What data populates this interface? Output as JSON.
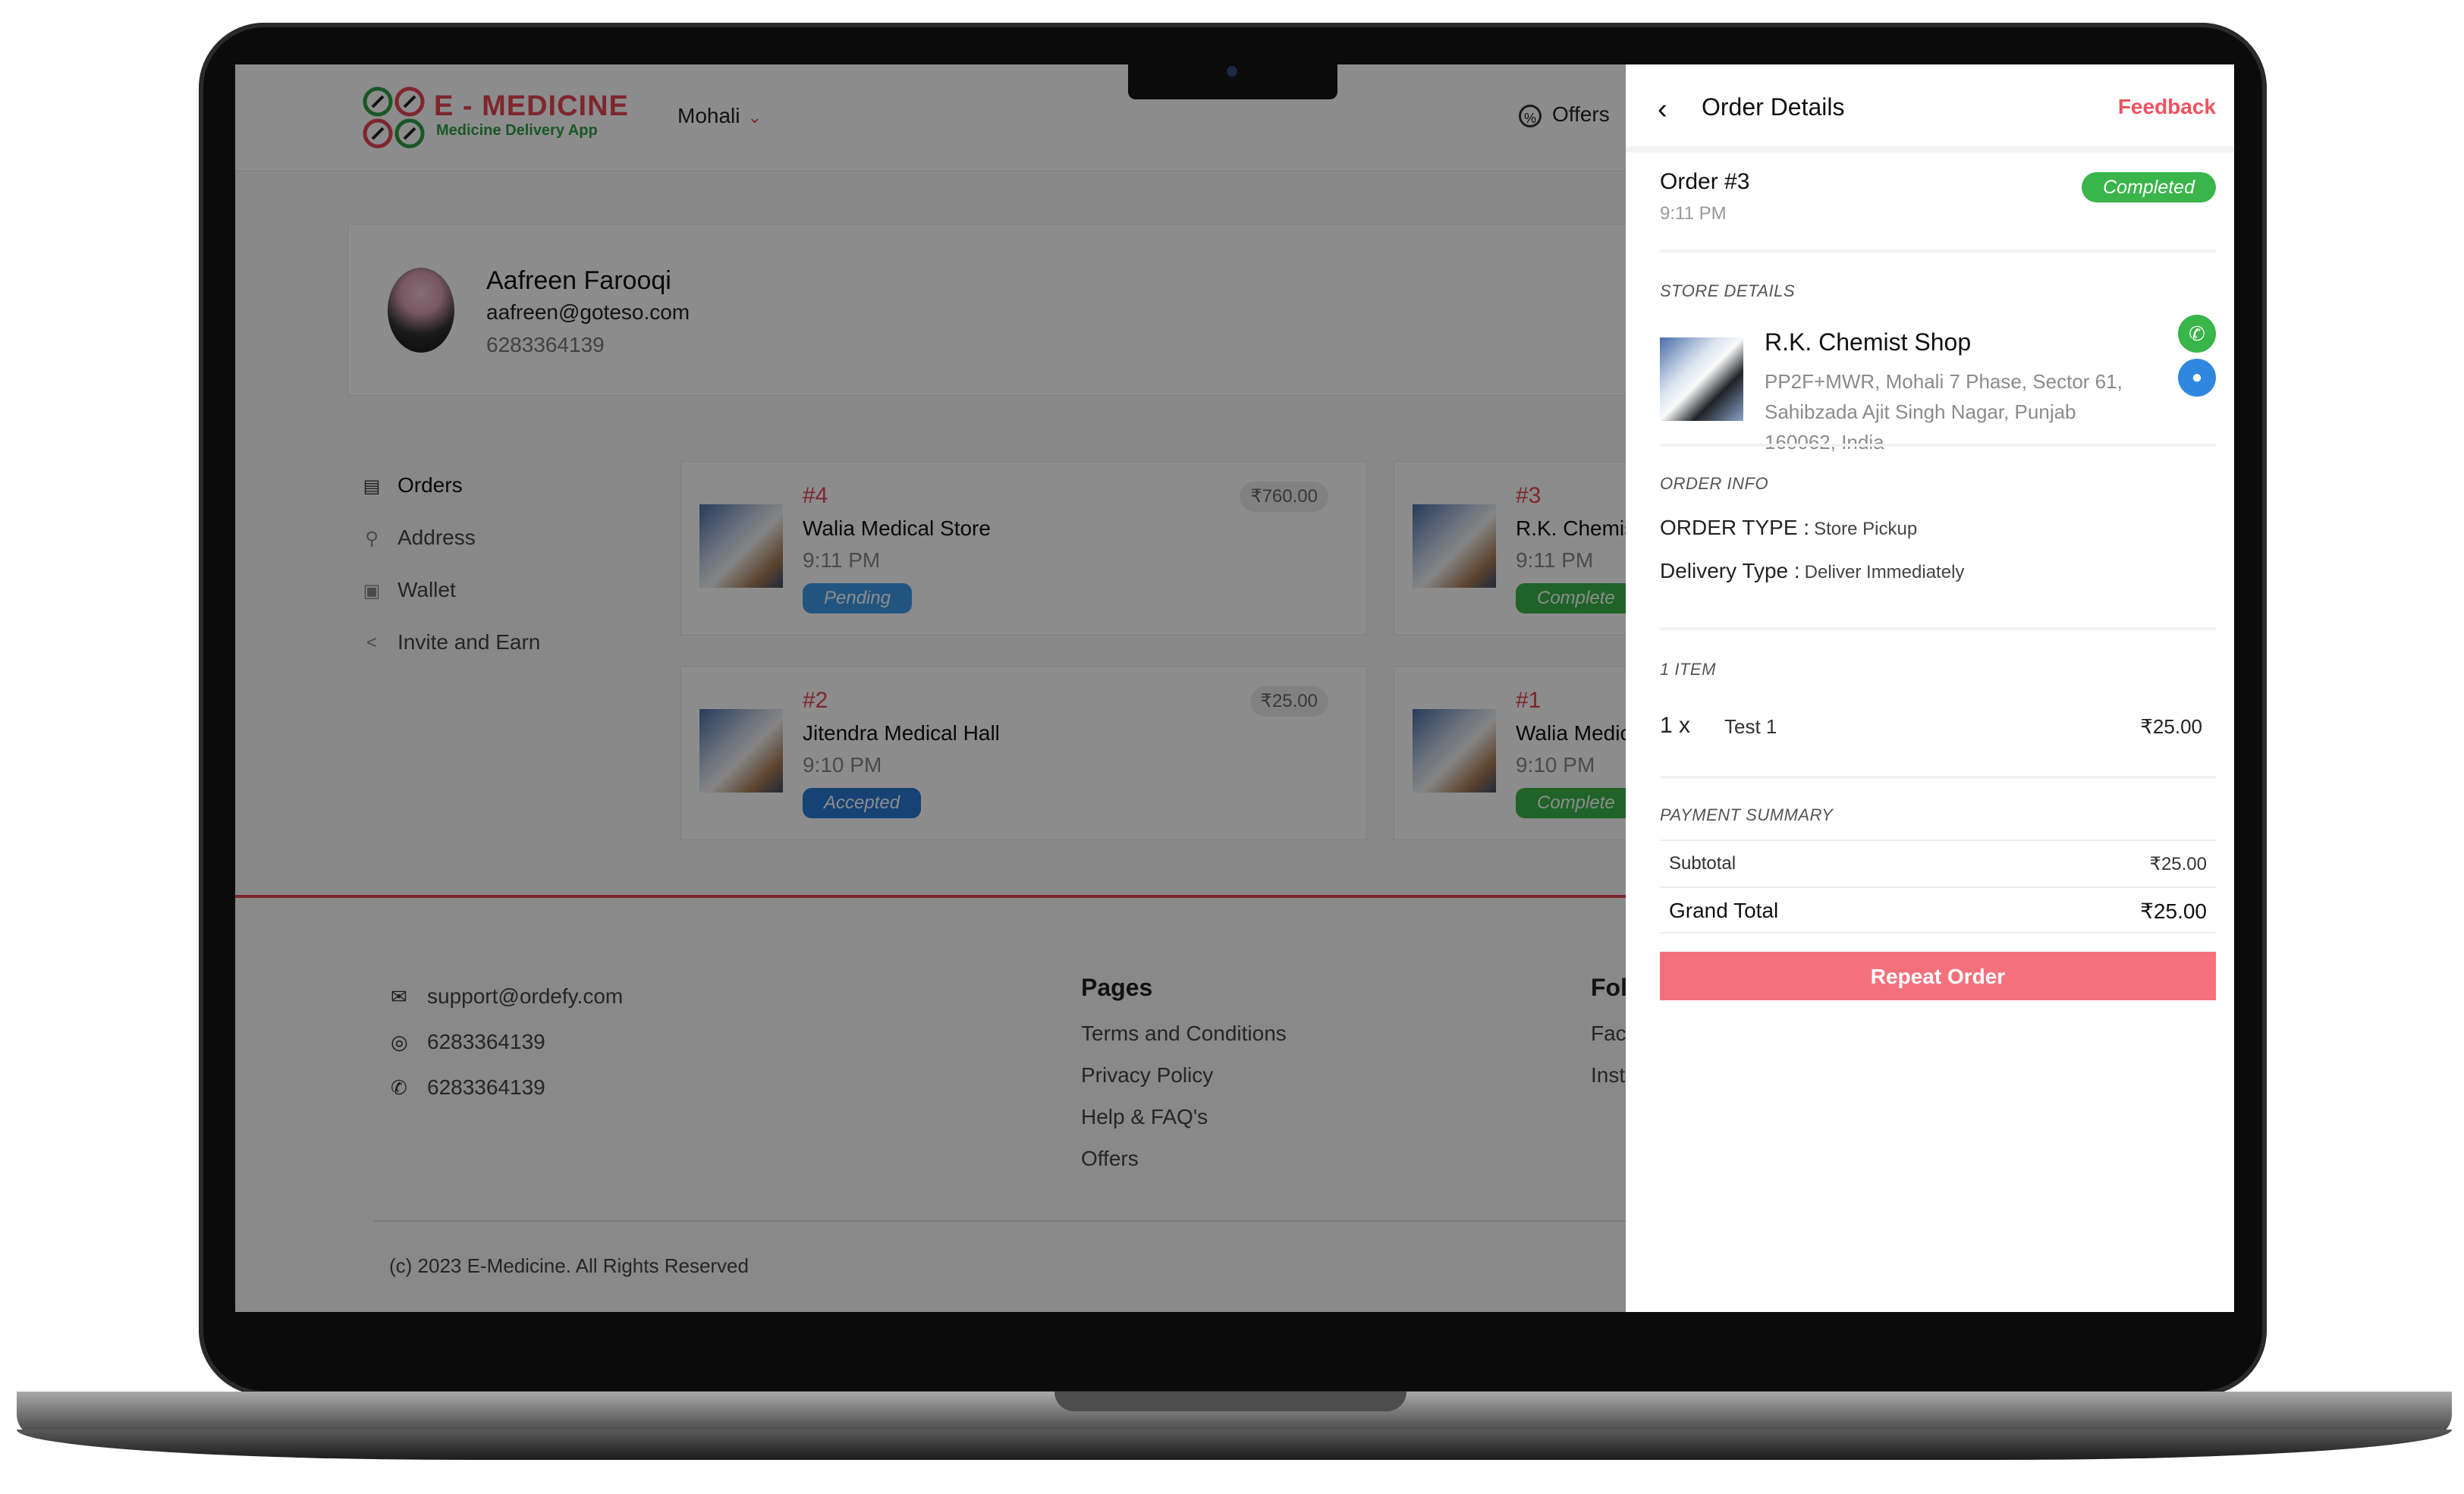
{
  "header": {
    "logo_title": "E - MEDICINE",
    "logo_subtitle": "Medicine Delivery App",
    "city": "Mohali",
    "offers_label": "Offers"
  },
  "profile": {
    "name": "Aafreen Farooqi",
    "email": "aafreen@goteso.com",
    "phone": "6283364139"
  },
  "menu": {
    "items": [
      {
        "label": "Orders",
        "icon": "clipboard-icon"
      },
      {
        "label": "Address",
        "icon": "location-pin-icon"
      },
      {
        "label": "Wallet",
        "icon": "wallet-icon"
      },
      {
        "label": "Invite and Earn",
        "icon": "share-icon"
      }
    ]
  },
  "orders": [
    {
      "id": "#4",
      "store": "Walia Medical Store",
      "time": "9:11 PM",
      "status": "Pending",
      "price": "₹760.00"
    },
    {
      "id": "#3",
      "store": "R.K. Chemis",
      "time": "9:11 PM",
      "status": "Complete",
      "price": ""
    },
    {
      "id": "#2",
      "store": "Jitendra Medical Hall",
      "time": "9:10 PM",
      "status": "Accepted",
      "price": "₹25.00"
    },
    {
      "id": "#1",
      "store": "Walia Medic",
      "time": "9:10 PM",
      "status": "Complete",
      "price": ""
    }
  ],
  "footer": {
    "email": "support@ordefy.com",
    "whatsapp": "6283364139",
    "phone": "6283364139",
    "pages_heading": "Pages",
    "pages": [
      "Terms and Conditions",
      "Privacy Policy",
      "Help & FAQ's",
      "Offers"
    ],
    "follow_heading": "Fol",
    "follow": [
      "Fac",
      "Inst"
    ],
    "copyright": "(c) 2023 E-Medicine. All Rights Reserved"
  },
  "panel": {
    "title": "Order Details",
    "feedback": "Feedback",
    "order_number": "Order #3",
    "order_time": "9:11 PM",
    "status": "Completed",
    "store_section": "STORE DETAILS",
    "store_name": "R.K. Chemist Shop",
    "store_address": "PP2F+MWR, Mohali 7 Phase, Sector 61, Sahibzada Ajit Singh Nagar, Punjab 160062, India",
    "order_info_section": "ORDER INFO",
    "order_type_label": "ORDER TYPE :",
    "order_type_value": "Store Pickup",
    "delivery_type_label": "Delivery Type :",
    "delivery_type_value": "Deliver Immediately",
    "items_section": "1 ITEM",
    "item": {
      "qty": "1 x",
      "name": "Test 1",
      "price": "₹25.00"
    },
    "payment_section": "PAYMENT SUMMARY",
    "subtotal_label": "Subtotal",
    "subtotal_value": "₹25.00",
    "grand_total_label": "Grand Total",
    "grand_total_value": "₹25.00",
    "repeat_button": "Repeat Order"
  },
  "colors": {
    "brand_red": "#e64552",
    "pending": "#3d9be9",
    "accepted": "#2b78d4",
    "completed": "#39b54a",
    "repeat_button": "#f4717c"
  }
}
